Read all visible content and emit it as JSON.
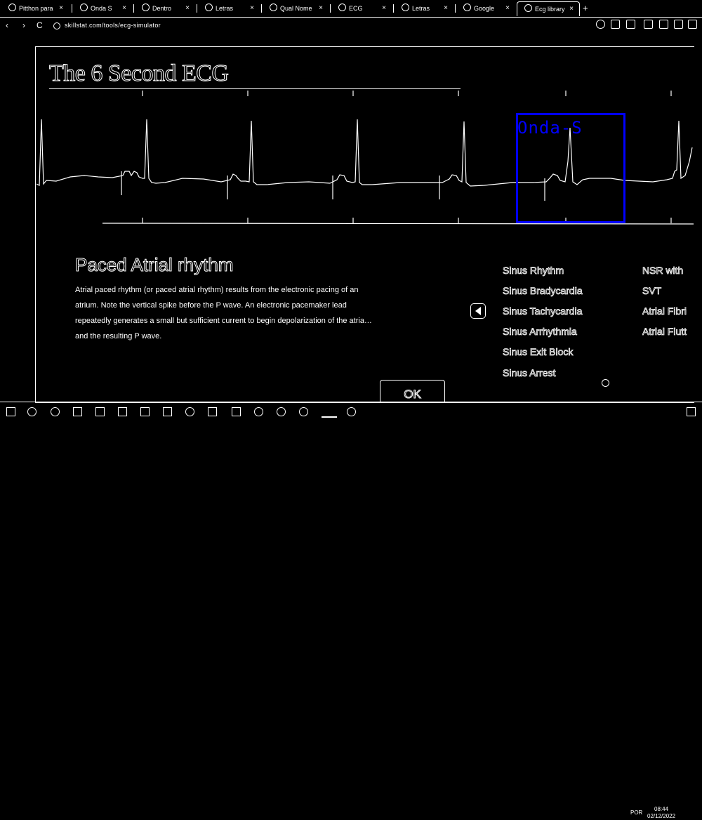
{
  "browser": {
    "tabs": [
      {
        "label": "Pitthon para",
        "active": false
      },
      {
        "label": "Onda S",
        "active": false
      },
      {
        "label": "Dentro",
        "active": false
      },
      {
        "label": "Letras",
        "active": false
      },
      {
        "label": "Qual Nome",
        "active": false
      },
      {
        "label": "ECG",
        "active": false
      },
      {
        "label": "Letras",
        "active": false
      },
      {
        "label": "Google",
        "active": false
      },
      {
        "label": "Ecg library",
        "active": true
      }
    ],
    "new_tab": "+",
    "close": "×",
    "url": "skillstat.com/tools/ecg-simulator",
    "nav": {
      "back": "‹",
      "forward": "›",
      "reload": "C"
    }
  },
  "app": {
    "title": "The 6 Second ECG",
    "annotation": "Onda-S",
    "rhythm_name": "Paced Atrial rhythm",
    "description_lines": [
      "Atrial paced rhythm (or paced atrial rhythm) results from the electronic pacing of an",
      "atrium. Note the vertical spike before the P wave. An electronic pacemaker lead",
      "repeatedly generates a small but sufficient current to begin depolarization of the atria…",
      "and the resulting P wave."
    ],
    "rhythms_col1": [
      "Sinus Rhythm",
      "Sinus Bradycardia",
      "Sinus Tachycardia",
      "Sinus Arrhythmia",
      "Sinus Exit Block",
      "Sinus Arrest"
    ],
    "rhythms_col2": [
      "NSR with",
      "SVT",
      "Atrial Fibri",
      "Atrial Flutt"
    ],
    "ok_label": "OK",
    "annotation_color": "#0000ff"
  },
  "taskbar": {
    "system_text": "POR",
    "time": "08:44",
    "date": "02/12/2022"
  }
}
